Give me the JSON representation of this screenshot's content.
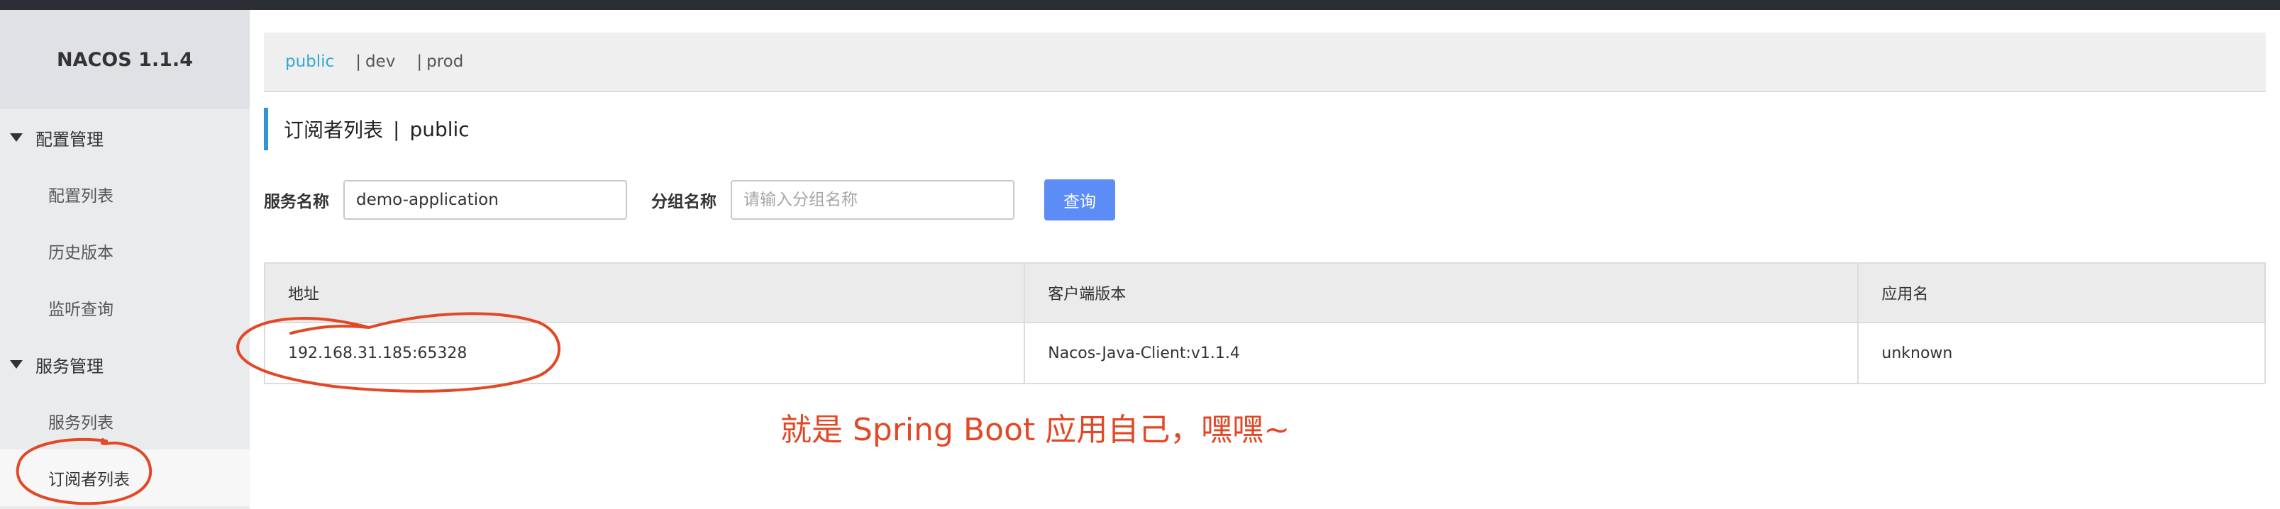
{
  "app": {
    "title": "NACOS 1.1.4"
  },
  "sidebar": {
    "groups": [
      {
        "label": "配置管理",
        "items": [
          "配置列表",
          "历史版本",
          "监听查询"
        ]
      },
      {
        "label": "服务管理",
        "items": [
          "服务列表",
          "订阅者列表"
        ]
      }
    ],
    "active_item": "订阅者列表"
  },
  "namespaces": {
    "items": [
      "public",
      "dev",
      "prod"
    ],
    "separator": "|",
    "current": "public"
  },
  "page": {
    "title": "订阅者列表",
    "title_sep": "|",
    "namespace": "public"
  },
  "search": {
    "service_label": "服务名称",
    "service_value": "demo-application",
    "group_label": "分组名称",
    "group_placeholder": "请输入分组名称",
    "query_button": "查询"
  },
  "table": {
    "columns": [
      "地址",
      "客户端版本",
      "应用名"
    ],
    "rows": [
      [
        "192.168.31.185:65328",
        "Nacos-Java-Client:v1.1.4",
        "unknown"
      ]
    ]
  },
  "annotation": {
    "text": "就是 Spring Boot 应用自己，嘿嘿~",
    "color": "#e24826"
  },
  "colors": {
    "accent": "#33a9d6",
    "button": "#5c8df6",
    "title_bar": "#2f95d9"
  }
}
